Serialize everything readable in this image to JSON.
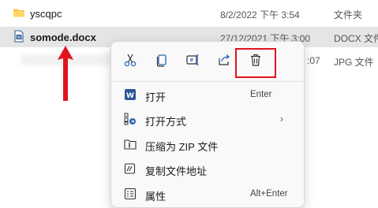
{
  "files": [
    {
      "name": "yscqpc",
      "date": "8/2/2022 下午 3:54",
      "type": "文件夹",
      "icon": "folder-icon"
    },
    {
      "name": "somode.docx",
      "date": "27/12/2021 下午 3:00",
      "type": "DOCX 文件",
      "icon": "word-doc-icon"
    },
    {
      "name": "",
      "date": ":07",
      "type": "JPG 文件",
      "icon": "image-file-icon"
    }
  ],
  "context_menu": {
    "toolbar": [
      "cut-icon",
      "copy-icon",
      "rename-icon",
      "share-icon",
      "delete-icon"
    ],
    "items": [
      {
        "label": "打开",
        "shortcut": "Enter",
        "icon": "word-app-icon"
      },
      {
        "label": "打开方式",
        "shortcut": "",
        "icon": "open-with-icon",
        "submenu": true
      },
      {
        "label": "压缩为 ZIP 文件",
        "shortcut": "",
        "icon": "zip-icon"
      },
      {
        "label": "复制文件地址",
        "shortcut": "",
        "icon": "copy-path-icon"
      },
      {
        "label": "属性",
        "shortcut": "Alt+Enter",
        "icon": "properties-icon"
      }
    ],
    "submenu_chevron": "›"
  },
  "colors": {
    "annotation": "#e0141e",
    "selected_row": "#e5e5e5",
    "folder": "#f5c242",
    "word_blue": "#2b5797",
    "image_blue": "#2f7ed8"
  }
}
